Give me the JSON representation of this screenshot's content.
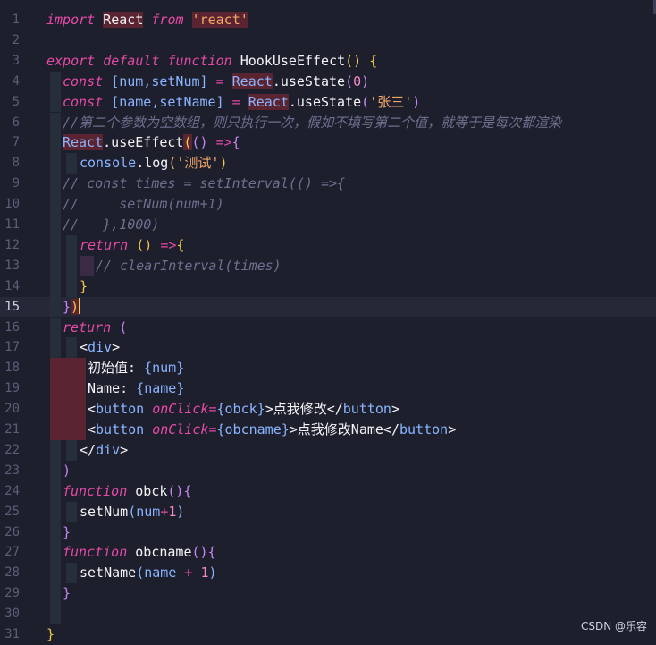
{
  "editor": {
    "line_numbers": [
      "1",
      "2",
      "3",
      "4",
      "5",
      "6",
      "7",
      "8",
      "9",
      "10",
      "11",
      "12",
      "13",
      "14",
      "15",
      "16",
      "17",
      "18",
      "19",
      "20",
      "21",
      "22",
      "23",
      "24",
      "25",
      "26",
      "27",
      "28",
      "29",
      "30",
      "31"
    ],
    "current_line": "15"
  },
  "code": {
    "l1": {
      "a": "import",
      "b": "React",
      "c": "from",
      "d": "'react'"
    },
    "l3": {
      "a": "export",
      "b": "default",
      "c": "function",
      "d": "HookUseEffect",
      "e": "()",
      "f": "{"
    },
    "l4": {
      "a": "const",
      "b": "[num,setNum]",
      "c": "=",
      "d": "React",
      ".e": ".useState",
      "f": "(",
      "g": "0",
      "h": ")"
    },
    "l5": {
      "a": "const",
      "b": "[name,setName]",
      "c": "=",
      "d": "React",
      "e": ".useState",
      "f": "(",
      "g": "'张三'",
      "h": ")"
    },
    "l6": {
      "a": "//第二个参数为空数组，则只执行一次，假如不填写第二个值，就等于是每次都渲染"
    },
    "l7": {
      "a": "React",
      "b": ".useEffect",
      "c": "(",
      "d": "()",
      "e": "=>",
      "f": "{"
    },
    "l8": {
      "a": "console",
      "b": ".log",
      "c": "(",
      "d": "'测试'",
      "e": ")"
    },
    "l9": {
      "a": "// const times = setInterval(() =>{"
    },
    "l10": {
      "a": "//     setNum(num+1)"
    },
    "l11": {
      "a": "//   },1000)"
    },
    "l12": {
      "a": "return",
      "b": "()",
      "c": "=>",
      "d": "{"
    },
    "l13": {
      "a": "// clearInterval(times)"
    },
    "l14": {
      "a": "}"
    },
    "l15": {
      "a": "}",
      "b": ")"
    },
    "l16": {
      "a": "return",
      "b": "("
    },
    "l17": {
      "a": "<",
      "b": "div",
      "c": ">"
    },
    "l18": {
      "a": "初始值: ",
      "b": "{",
      "c": "num",
      "d": "}"
    },
    "l19": {
      "a": "Name: ",
      "b": "{",
      "c": "name",
      "d": "}"
    },
    "l20": {
      "a": "<",
      "b": "button",
      "c": "onClick",
      "d": "=",
      "e": "{",
      "f": "obck",
      "g": "}",
      "h": ">点我修改</",
      "i": "button",
      "j": ">"
    },
    "l21": {
      "a": "<",
      "b": "button",
      "c": "onClick",
      "d": "=",
      "e": "{",
      "f": "obcname",
      "g": "}",
      "h": ">点我修改Name</",
      "i": "button",
      "j": ">"
    },
    "l22": {
      "a": "</",
      "b": "div",
      "c": ">"
    },
    "l23": {
      "a": ")"
    },
    "l24": {
      "a": "function",
      "b": "obck",
      "c": "()",
      "d": "{"
    },
    "l25": {
      "a": "setNum",
      "b": "(",
      "c": "num",
      "d": "+",
      "e": "1",
      "f": ")"
    },
    "l26": {
      "a": "}"
    },
    "l27": {
      "a": "function",
      "b": "obcname",
      "c": "()",
      "d": "{"
    },
    "l28": {
      "a": "setName",
      "b": "(",
      "c": "name",
      "d": "+",
      "e": "1",
      "f": ")"
    },
    "l29": {
      "a": "}"
    },
    "l31": {
      "a": "}"
    }
  },
  "watermark": "CSDN @乐容"
}
